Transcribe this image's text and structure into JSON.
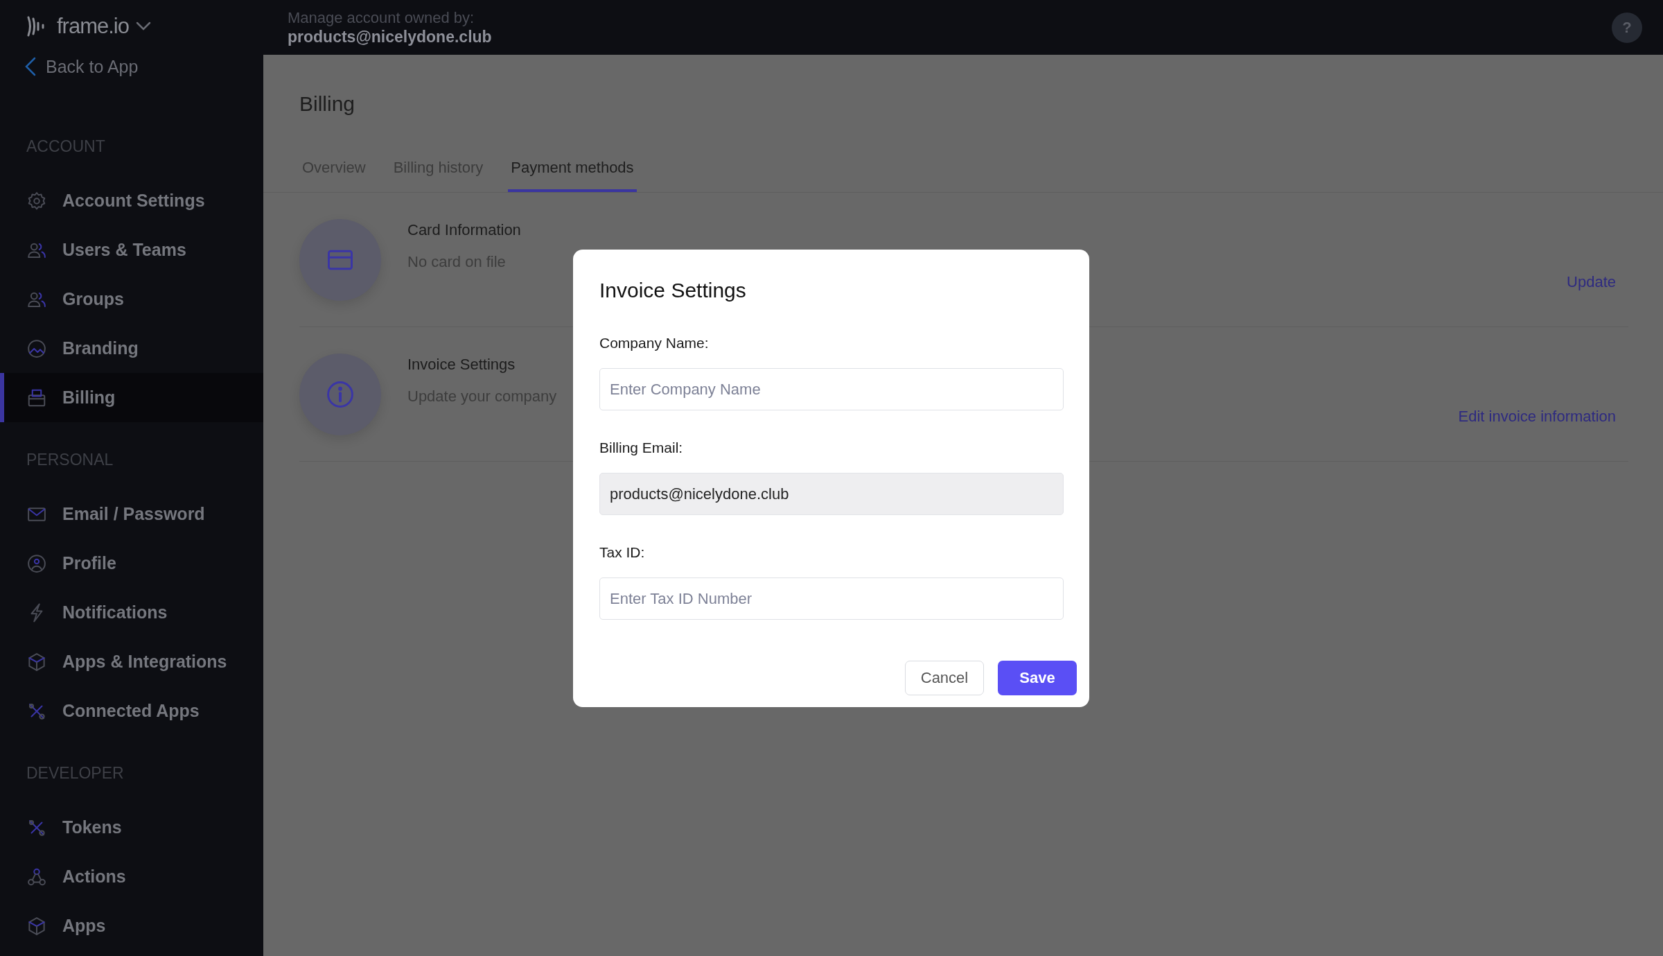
{
  "app": {
    "logo": "frame.io",
    "back_link": "Back to App"
  },
  "header": {
    "caption": "Manage account owned by:",
    "owner": "products@nicelydone.club",
    "help_label": "?"
  },
  "sidebar": {
    "sections": [
      {
        "title": "ACCOUNT",
        "items": [
          {
            "label": "Account Settings",
            "selected": false
          },
          {
            "label": "Users & Teams",
            "selected": false
          },
          {
            "label": "Groups",
            "selected": false
          },
          {
            "label": "Branding",
            "selected": false
          },
          {
            "label": "Billing",
            "selected": true
          }
        ]
      },
      {
        "title": "PERSONAL",
        "items": [
          {
            "label": "Email / Password",
            "selected": false
          },
          {
            "label": "Profile",
            "selected": false
          },
          {
            "label": "Notifications",
            "selected": false
          },
          {
            "label": "Apps & Integrations",
            "selected": false
          },
          {
            "label": "Connected Apps",
            "selected": false
          }
        ]
      },
      {
        "title": "DEVELOPER",
        "items": [
          {
            "label": "Tokens",
            "selected": false
          },
          {
            "label": "Actions",
            "selected": false
          },
          {
            "label": "Apps",
            "selected": false
          }
        ]
      }
    ]
  },
  "page": {
    "title": "Billing",
    "tabs": [
      {
        "label": "Overview",
        "selected": false
      },
      {
        "label": "Billing history",
        "selected": false
      },
      {
        "label": "Payment methods",
        "selected": true
      }
    ],
    "rows": [
      {
        "title": "Card Information",
        "description": "No card on file",
        "action": "Update"
      },
      {
        "title": "Invoice Settings",
        "description": "Update your company",
        "action": "Edit invoice information"
      }
    ]
  },
  "dialog": {
    "title": "Invoice Settings",
    "fields": [
      {
        "label": "Company Name:",
        "placeholder": "Enter Company Name",
        "disabled": false
      },
      {
        "label": "Billing Email:",
        "value": "products@nicelydone.club",
        "disabled": true
      },
      {
        "label": "Tax ID:",
        "placeholder": "Enter Tax ID Number",
        "disabled": false
      }
    ],
    "buttons": [
      {
        "label": "Cancel",
        "kind": "secondary"
      },
      {
        "label": "Save",
        "kind": "primary"
      }
    ]
  }
}
